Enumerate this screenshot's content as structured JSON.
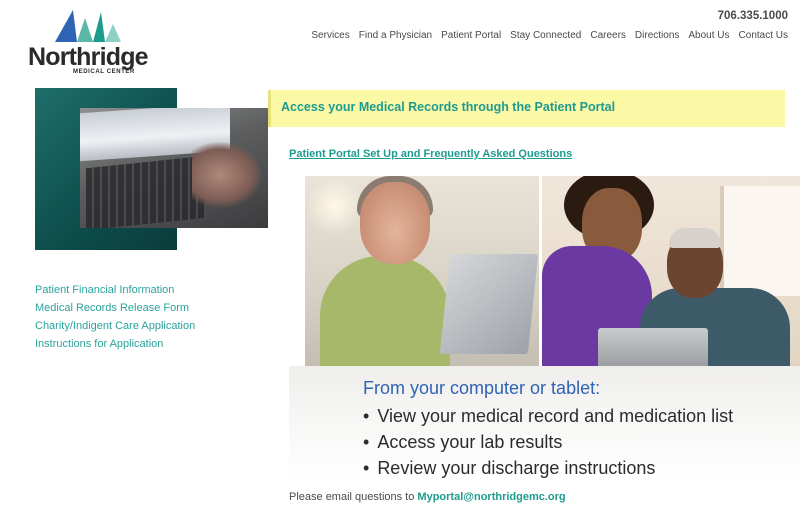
{
  "brand": {
    "name": "Northridge",
    "subtitle": "MEDICAL CENTER",
    "colors": {
      "teal": "#1e9b8f",
      "blue": "#2f63b4",
      "yellow_banner": "#fbf8a6"
    }
  },
  "header": {
    "phone": "706.335.1000",
    "nav": [
      "Services",
      "Find a Physician",
      "Patient Portal",
      "Stay Connected",
      "Careers",
      "Directions",
      "About Us",
      "Contact Us"
    ]
  },
  "sidebar": {
    "links": [
      "Patient Financial Information",
      "Medical Records Release Form",
      "Charity/Indigent Care Application",
      "Instructions for Application"
    ]
  },
  "main": {
    "banner_title": "Access your Medical Records through the Patient Portal",
    "subhead": "Patient Portal Set Up and Frequently Asked Questions",
    "features_lead": "From your computer or tablet:",
    "features": [
      "View your medical record and medication list",
      "Access your lab results",
      "Review your discharge instructions"
    ],
    "email_prefix": "Please email questions to ",
    "email": "Myportal@northridgemc.org"
  }
}
